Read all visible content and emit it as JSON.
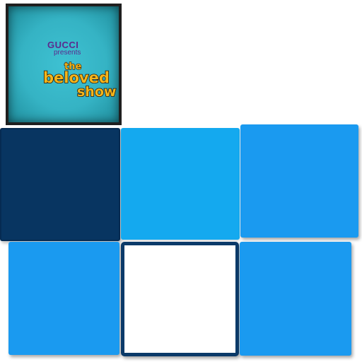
{
  "poster": {
    "brand": "GUCCI",
    "presents": "presents",
    "logo_the": "the",
    "logo_beloved": "beloved",
    "logo_show": "show",
    "colors": {
      "background": "#35b3c4",
      "logo_fill": "#f3b51b",
      "logo_outline": "#2a1505",
      "brand": "#5b2a8e"
    }
  },
  "grid": {
    "rows": 2,
    "cols": 3,
    "tiles": [
      {
        "state": "dark",
        "color": "#083561"
      },
      {
        "state": "light",
        "color": "#14a9ef"
      },
      {
        "state": "raised",
        "color": "#1a9af0"
      },
      {
        "state": "raised",
        "color": "#1a9af0"
      },
      {
        "state": "empty-selected",
        "color": "#ffffff"
      },
      {
        "state": "raised",
        "color": "#1a9af0"
      }
    ]
  }
}
